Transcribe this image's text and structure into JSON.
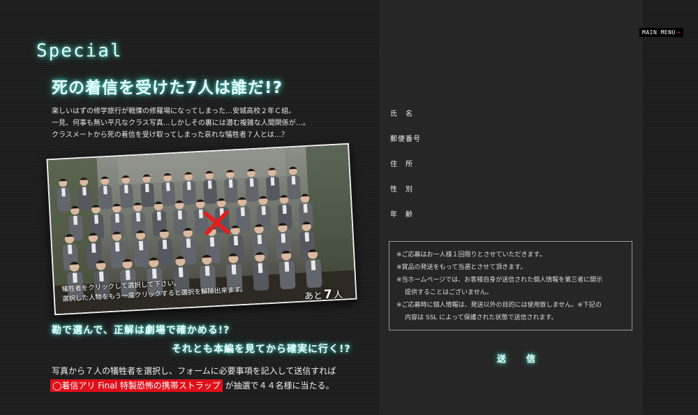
{
  "nav": {
    "main_menu": "MAIN MENU"
  },
  "section_title": "Special",
  "headline": "死の着信を受けた7人は誰だ!?",
  "intro": [
    "楽しいはずの修学旅行が戦慄の修羅場になってしまった…安城高校２年Ｃ組。",
    "一見、何事も無い平凡なクラス写真…しかしその裏には潜む複雑な人間関係が…。",
    "クラスメートから死の着信を受け取ってしまった哀れな犠牲者７人とは…？"
  ],
  "photo": {
    "instruction_1": "犠牲者をクリックして選択して下さい。",
    "instruction_2": "選択した人物をもう一度クリックすると選択を解除出来ます。",
    "remaining_prefix": "あと",
    "remaining_count": "7",
    "remaining_suffix": "人"
  },
  "question_1": "勘で選んで、正解は劇場で確かめる!?",
  "question_2": "それとも本編を見てから確実に行く!?",
  "instruction_line": "写真から７人の犠牲者を選択し、フォームに必要事項を記入して送信すれば",
  "prize": "◯着信アリ Final 特製恐怖の携帯ストラップ",
  "prize_suffix": "が抽選で４４名様に当たる。",
  "form": {
    "name_label": "氏　名",
    "postal_label": "郵便番号",
    "address_label": "住　所",
    "gender_label": "性　別",
    "age_label": "年　齢"
  },
  "notes": [
    "※ご応募はお一人様１回限りとさせていただきます。",
    "※賞品の発送をもって当選とさせて頂きます。",
    "※当ホームページでは、お客様自身が送信された個人情報を第三者に開示",
    "提供することはございません。",
    "※ご応募時に個人情報は、発送以外の目的には使用致しません。※下記の",
    "内容は SSL によって保護された状態で送信されます。"
  ],
  "submit_label": "送　信",
  "colors": {
    "glow": "#5fe6d8",
    "prize_bg": "#e0101a",
    "mark": "#e02020"
  }
}
